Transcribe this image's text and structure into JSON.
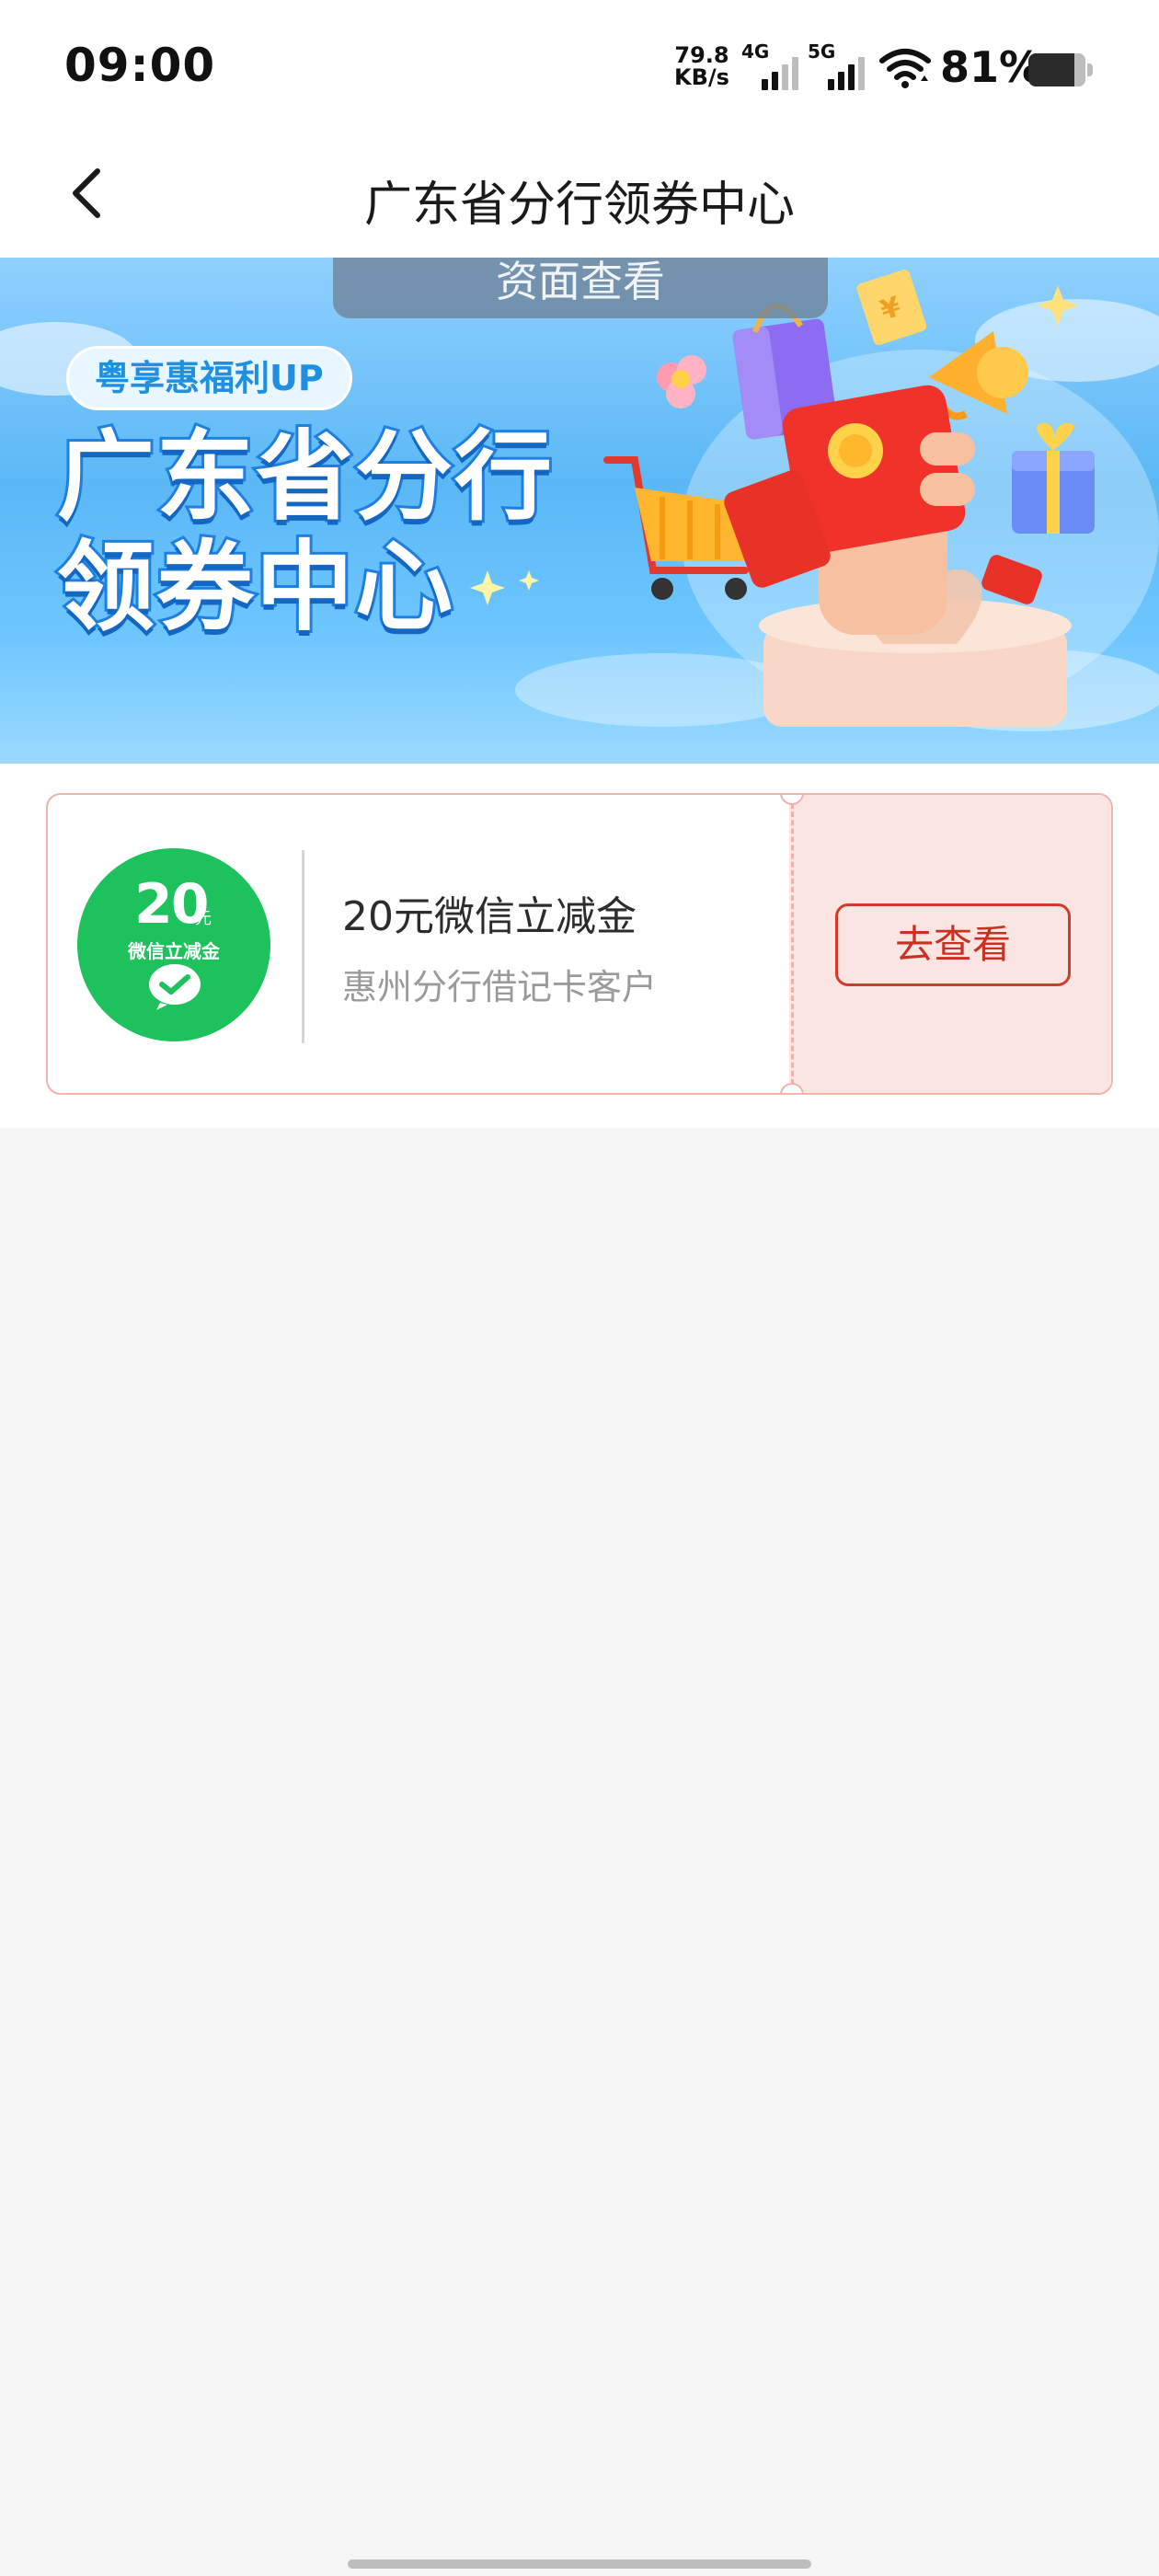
{
  "status_bar": {
    "time": "09:00",
    "net_speed_value": "79.8",
    "net_speed_unit": "KB/s",
    "sim1_label": "4G",
    "sim2_label": "5G",
    "battery_percent": "81%",
    "battery_level": 0.81
  },
  "nav": {
    "title": "广东省分行领券中心",
    "back_icon": "chevron-left-icon"
  },
  "banner": {
    "tab_text": "资面查看",
    "badge": "粤享惠福利UP",
    "title_line1": "广东省分行",
    "title_line2": "领券中心"
  },
  "coupon": {
    "badge_amount": "20",
    "badge_unit": "元",
    "badge_subtitle": "微信立减金",
    "badge_icon": "wechat-pay-icon",
    "title": "20元微信立减金",
    "subtitle": "惠州分行借记卡客户",
    "button_label": "去查看",
    "accent_color": "#d23b2c",
    "icon_color": "#1dc25c"
  }
}
